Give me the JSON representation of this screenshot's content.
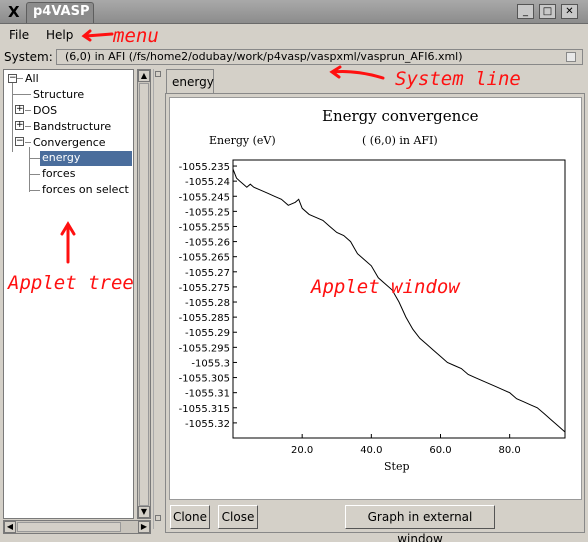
{
  "window": {
    "title": "p4VASP",
    "logo": "X",
    "minimize": "_",
    "maximize": "□",
    "close": "✕"
  },
  "menu": {
    "file": "File",
    "help": "Help"
  },
  "system": {
    "label": "System:",
    "value": "(6,0) in AFI (/fs/home2/odubay/work/p4vasp/vaspxml/vasprun_AFI6.xml)"
  },
  "tree": {
    "root": "All",
    "items": [
      {
        "label": "Structure"
      },
      {
        "label": "DOS"
      },
      {
        "label": "Bandstructure"
      },
      {
        "label": "Convergence"
      },
      {
        "label": "energy",
        "selected": true
      },
      {
        "label": "forces"
      },
      {
        "label": "forces on select"
      }
    ]
  },
  "tab": {
    "label": "energy"
  },
  "chart_data": {
    "type": "line",
    "title": "Energy convergence",
    "ylabel": "Energy (eV)",
    "subtitle": "( (6,0) in AFI)",
    "xlabel": "Step",
    "xlim": [
      0,
      96
    ],
    "ylim": [
      -1055.325,
      -1055.233
    ],
    "yticks": [
      "-1055.235",
      "-1055.24",
      "-1055.245",
      "-1055.25",
      "-1055.255",
      "-1055.26",
      "-1055.265",
      "-1055.27",
      "-1055.275",
      "-1055.28",
      "-1055.285",
      "-1055.29",
      "-1055.295",
      "-1055.3",
      "-1055.305",
      "-1055.31",
      "-1055.315",
      "-1055.32"
    ],
    "ytick_values": [
      -1055.235,
      -1055.24,
      -1055.245,
      -1055.25,
      -1055.255,
      -1055.26,
      -1055.265,
      -1055.27,
      -1055.275,
      -1055.28,
      -1055.285,
      -1055.29,
      -1055.295,
      -1055.3,
      -1055.305,
      -1055.31,
      -1055.315,
      -1055.32
    ],
    "xticks": [
      "20.0",
      "40.0",
      "60.0",
      "80.0"
    ],
    "xtick_values": [
      20,
      40,
      60,
      80
    ],
    "series": [
      {
        "x": [
          0,
          1,
          2,
          3,
          4,
          5,
          6,
          8,
          10,
          12,
          14,
          16,
          18,
          19,
          20,
          22,
          24,
          26,
          28,
          30,
          32,
          34,
          35,
          36,
          38,
          40,
          42,
          44,
          46,
          48,
          50,
          52,
          54,
          56,
          58,
          60,
          62,
          64,
          66,
          68,
          70,
          72,
          74,
          76,
          78,
          80,
          82,
          84,
          86,
          88,
          90,
          92,
          94,
          96
        ],
        "y": [
          -1055.236,
          -1055.239,
          -1055.24,
          -1055.241,
          -1055.242,
          -1055.241,
          -1055.242,
          -1055.243,
          -1055.244,
          -1055.245,
          -1055.246,
          -1055.248,
          -1055.247,
          -1055.246,
          -1055.249,
          -1055.251,
          -1055.252,
          -1055.253,
          -1055.255,
          -1055.257,
          -1055.258,
          -1055.26,
          -1055.262,
          -1055.264,
          -1055.266,
          -1055.268,
          -1055.272,
          -1055.274,
          -1055.276,
          -1055.28,
          -1055.285,
          -1055.289,
          -1055.292,
          -1055.294,
          -1055.296,
          -1055.298,
          -1055.3,
          -1055.301,
          -1055.302,
          -1055.304,
          -1055.305,
          -1055.306,
          -1055.307,
          -1055.308,
          -1055.309,
          -1055.31,
          -1055.312,
          -1055.313,
          -1055.314,
          -1055.315,
          -1055.317,
          -1055.319,
          -1055.321,
          -1055.323
        ]
      }
    ]
  },
  "buttons": {
    "clone": "Clone",
    "close": "Close",
    "external": "Graph in external window"
  },
  "annotations": {
    "menu": "menu",
    "system": "System line",
    "tree": "Applet tree",
    "applet": "Applet window"
  }
}
